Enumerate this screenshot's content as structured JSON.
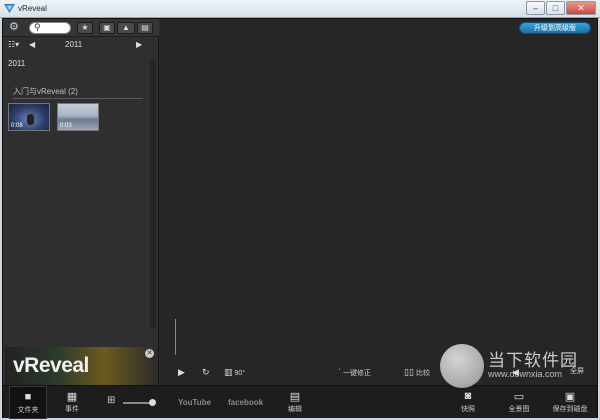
{
  "window": {
    "title": "vReveal",
    "controls": [
      "–",
      "□",
      "✕"
    ]
  },
  "left_panel": {
    "toolbar": {
      "gear_icon": "gear-icon",
      "search_placeholder": "",
      "star": "★",
      "camera": "▣",
      "hills": "▲",
      "film": "▤"
    },
    "year_nav": {
      "menu": "☷▾",
      "prev": "◀",
      "year": "2011",
      "next": "▶"
    },
    "year_label": "2011",
    "album": {
      "title": "入门与vReveal (2)",
      "thumbnails": [
        {
          "duration": "0:08"
        },
        {
          "duration": "0:03"
        }
      ]
    },
    "brand": {
      "text": "vReveal",
      "close": "✕"
    }
  },
  "main": {
    "upgrade_label": "升级到高级版",
    "controls": {
      "play": "▶",
      "rotate": "↻",
      "rotate_90": "90°",
      "one_click_fix": "一键修正",
      "compare": "比较",
      "prev": "◀",
      "fullscreen": "全屏"
    }
  },
  "bottom_bar": {
    "folders_label": "文件夹",
    "events_label": "事件",
    "zoom_icon": "zoom-icon",
    "youtube_label": "YouTube",
    "facebook_label": "facebook",
    "edit_label": "编辑",
    "snapshot_label": "快照",
    "full_screen_label": "全景图",
    "save_label": "保存到磁盘"
  },
  "watermark": {
    "text": "当下软件园",
    "url": "www.downxia.com"
  },
  "colors": {
    "accent": "#1a6fa3",
    "background": "#2b2b2b",
    "panel": "#2f2f2f"
  }
}
